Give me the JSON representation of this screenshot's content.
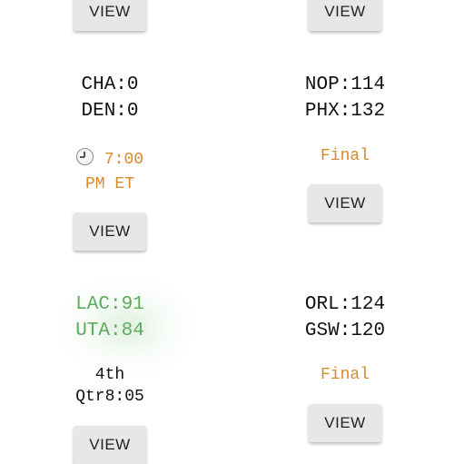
{
  "view_label": "VIEW",
  "games": [
    {
      "team1": "CHA:0",
      "team2": "DEN:0",
      "status_line1": "7:00",
      "status_line2": "PM ET"
    },
    {
      "team1": "NOP:114",
      "team2": "PHX:132",
      "status": "Final"
    },
    {
      "team1": "LAC:91",
      "team2": "UTA:84",
      "status_line1": "4th",
      "status_line2": "Qtr8:05"
    },
    {
      "team1": "ORL:124",
      "team2": "GSW:120",
      "status": "Final"
    }
  ],
  "colors": {
    "live": "#5cab5e",
    "status_orange": "#d68a2c",
    "button_bg": "#e7e7e7"
  },
  "icons": {
    "scheduled": "clock-icon"
  }
}
